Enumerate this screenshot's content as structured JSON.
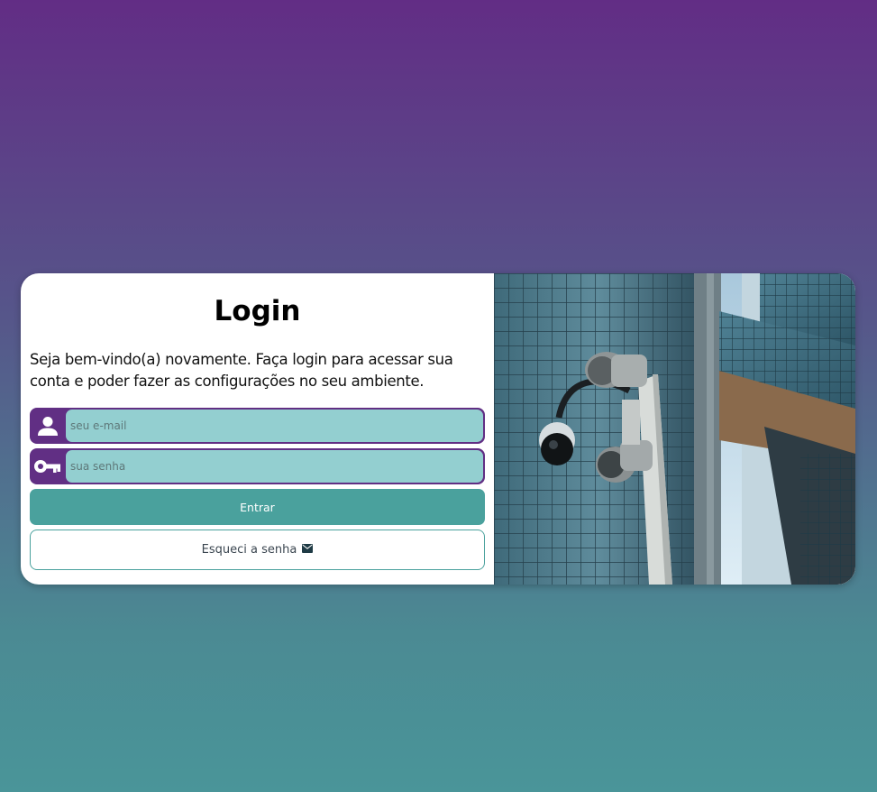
{
  "login": {
    "title": "Login",
    "welcome": "Seja bem-vindo(a) novamente. Faça login para acessar sua conta e poder fazer as configurações no seu ambiente.",
    "email": {
      "value": "",
      "placeholder": "seu e-mail",
      "icon": "user-icon"
    },
    "password": {
      "value": "",
      "placeholder": "sua senha",
      "icon": "key-icon"
    },
    "submit_label": "Entrar",
    "forgot_label": "Esqueci a senha",
    "forgot_icon": "envelope-icon"
  },
  "image": {
    "subject": "security-camera-photo"
  },
  "colors": {
    "gradient_top": "#622d85",
    "gradient_bottom": "#4a9599",
    "accent_purple": "#612f84",
    "input_fill": "#93cfd0",
    "button_teal": "#4aa19d"
  }
}
